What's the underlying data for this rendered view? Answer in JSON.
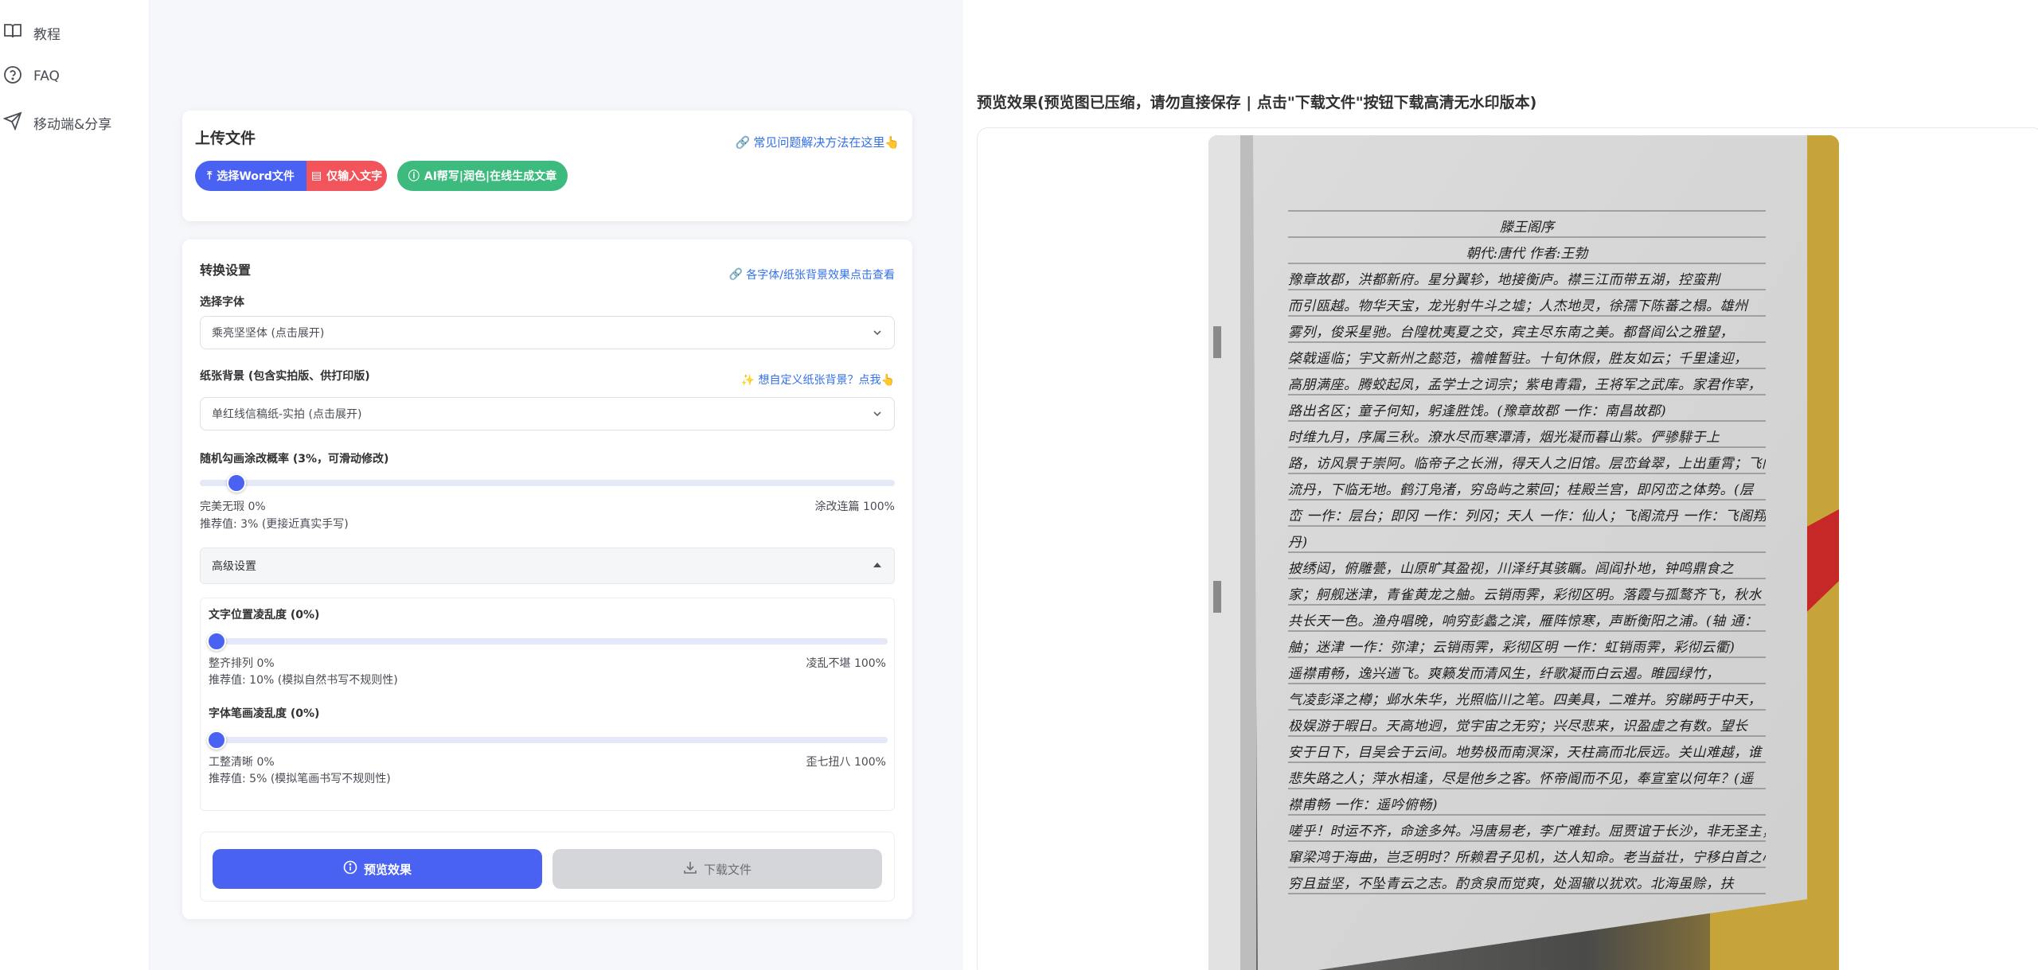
{
  "sidebar": {
    "items": [
      {
        "label": "教程",
        "icon": "book-icon"
      },
      {
        "label": "FAQ",
        "icon": "question-circle-icon"
      },
      {
        "label": "移动端&分享",
        "icon": "send-icon"
      }
    ]
  },
  "upload": {
    "title": "上传文件",
    "faq_link": "常见问题解决方法在这里👆",
    "select_word_button": "选择Word文件",
    "input_text_button": "仅输入文字",
    "ai_button": "AI帮写|润色|在线生成文章"
  },
  "settings": {
    "title": "转换设置",
    "fonts_link": "各字体/纸张背景效果点击查看",
    "font_label": "选择字体",
    "font_value": "乘亮坚坚体 (点击展开)",
    "paper_label": "纸张背景 (包含实拍版、供打印版)",
    "paper_link": "✨ 想自定义纸张背景？点我👆",
    "paper_value": "单红线信稿纸-实拍 (点击展开)",
    "scribble_label": "随机勾画涂改概率 (3%，可滑动修改)",
    "scribble_value": 0.03,
    "scribble_min": "完美无瑕 0%",
    "scribble_max": "涂改连篇 100%",
    "scribble_hint": "推荐值: 3% (更接近真实手写)",
    "advanced_label": "高级设置",
    "position_label": "文字位置凌乱度 (0%)",
    "position_value": 0,
    "position_min": "整齐排列 0%",
    "position_max": "凌乱不堪 100%",
    "position_hint": "推荐值: 10% (模拟自然书写不规则性)",
    "stroke_label": "字体笔画凌乱度 (0%)",
    "stroke_value": 0,
    "stroke_min": "工整清晰 0%",
    "stroke_max": "歪七扭八 100%",
    "stroke_hint": "推荐值: 5% (模拟笔画书写不规则性)",
    "preview_button": "预览效果",
    "download_button": "下载文件"
  },
  "preview": {
    "title": "预览效果(预览图已压缩，请勿直接保存 | 点击\"下载文件\"按钮下载高清无水印版本)",
    "doc_title": "滕王阁序",
    "doc_author": "朝代:唐代 作者:王勃",
    "doc_lines": [
      "豫章故郡，洪都新府。星分翼轸，地接衡庐。襟三江而带五湖，控蛮荆",
      "而引瓯越。物华天宝，龙光射牛斗之墟；人杰地灵，徐孺下陈蕃之榻。雄州",
      "雾列，俊采星驰。台隍枕夷夏之交，宾主尽东南之美。都督阎公之雅望，",
      "棨戟遥临；宇文新州之懿范，襜帷暂驻。十旬休假，胜友如云；千里逢迎，",
      "高朋满座。腾蛟起凤，孟学士之词宗；紫电青霜，王将军之武库。家君作宰，",
      "路出名区；童子何知，躬逢胜饯。(豫章故郡 一作：南昌故郡)",
      "时维九月，序属三秋。潦水尽而寒潭清，烟光凝而暮山紫。俨骖騑于上",
      "路，访风景于崇阿。临帝子之长洲，得天人之旧馆。层峦耸翠，上出重霄；飞阁",
      "流丹，下临无地。鹤汀凫渚，穷岛屿之萦回；桂殿兰宫，即冈峦之体势。(层",
      "峦 一作：层台；即冈 一作：列冈；天人 一作：仙人；飞阁流丹 一作：飞阁翔",
      "丹)",
      "披绣闼，俯雕甍，山原旷其盈视，川泽纡其骇瞩。闾阎扑地，钟鸣鼎食之",
      "家；舸舰迷津，青雀黄龙之舳。云销雨霁，彩彻区明。落霞与孤鹜齐飞，秋水",
      "共长天一色。渔舟唱晚，响穷彭蠡之滨，雁阵惊寒，声断衡阳之浦。(轴 通：",
      "舳；迷津 一作：弥津；云销雨霁，彩彻区明 一作：虹销雨霁，彩彻云衢)",
      "遥襟甫畅，逸兴遄飞。爽籁发而清风生，纤歌凝而白云遏。睢园绿竹，",
      "气凌彭泽之樽；邺水朱华，光照临川之笔。四美具，二难并。穷睇眄于中天，",
      "极娱游于暇日。天高地迥，觉宇宙之无穷；兴尽悲来，识盈虚之有数。望长",
      "安于日下，目吴会于云间。地势极而南溟深，天柱高而北辰远。关山难越，谁",
      "悲失路之人；萍水相逢，尽是他乡之客。怀帝阍而不见，奉宣室以何年？(遥",
      "襟甫畅 一作：遥吟俯畅)",
      "嗟乎！时运不齐，命途多舛。冯唐易老，李广难封。屈贾谊于长沙，非无圣主；",
      "窜梁鸿于海曲，岂乏明时？所赖君子见机，达人知命。老当益壮，宁移白首之心？",
      "穷且益坚，不坠青云之志。酌贪泉而觉爽，处涸辙以犹欢。北海虽赊，扶"
    ]
  },
  "colors": {
    "primary": "#4a62f2",
    "red": "#f2545b",
    "green": "#3dba7e",
    "link": "#3370e8"
  }
}
